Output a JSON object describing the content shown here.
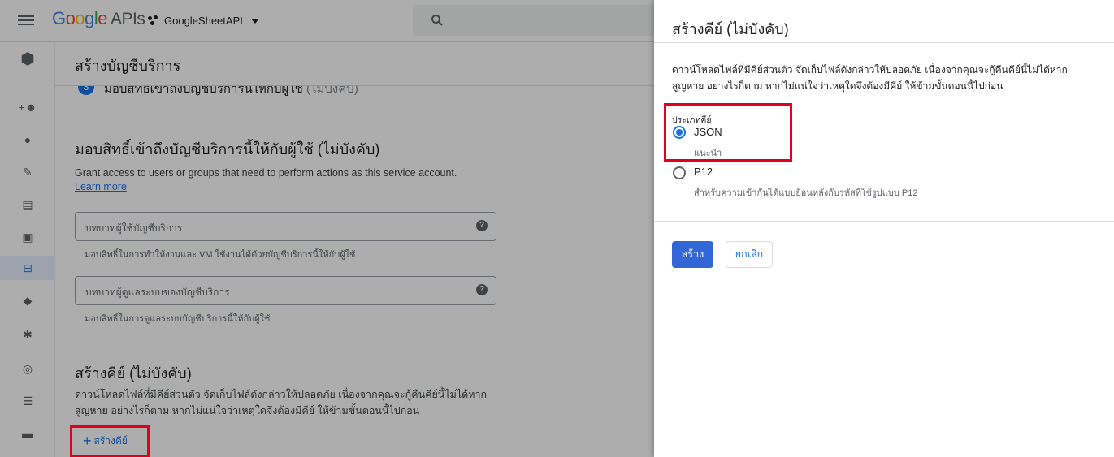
{
  "topbar": {
    "logo_parts": [
      "G",
      "o",
      "o",
      "g",
      "l",
      "e"
    ],
    "logo_suffix": "APIs",
    "project_name": "GoogleSheetAPI"
  },
  "sidebar": {
    "icons": [
      "iam-icon",
      "person-add-icon",
      "account-circle-icon",
      "wrench-icon",
      "article-icon",
      "storage-icon",
      "service-account-icon",
      "label-icon",
      "settings-icon",
      "security-icon",
      "list-icon",
      "folder-icon"
    ]
  },
  "page": {
    "title": "สร้างบัญชีบริการ",
    "step_number": "3",
    "step_text": "มอบสิทธิ์เข้าถึงบัญชีบริการนี้ให้กับผู้ใช้",
    "step_optional": "(ไม่บังคับ)",
    "grant": {
      "heading": "มอบสิทธิ์เข้าถึงบัญชีบริการนี้ให้กับผู้ใช้ (ไม่บังคับ)",
      "description": "Grant access to users or groups that need to perform actions as this service account.",
      "learn_more": "Learn more",
      "user_role_placeholder": "บทบาทผู้ใช้บัญชีบริการ",
      "user_role_hint": "มอบสิทธิ์ในการทำให้งานและ VM ใช้งานได้ด้วยบัญชีบริการนี้ให้กับผู้ใช้",
      "admin_role_placeholder": "บทบาทผู้ดูแลระบบของบัญชีบริการ",
      "admin_role_hint": "มอบสิทธิ์ในการดูแลระบบบัญชีบริการนี้ให้กับผู้ใช้"
    },
    "create_key": {
      "heading": "สร้างคีย์ (ไม่บังคับ)",
      "desc_line1": "ดาวน์โหลดไฟล์ที่มีคีย์ส่วนตัว จัดเก็บไฟล์ดังกล่าวให้ปลอดภัย เนื่องจากคุณจะกู้คืนคีย์นี้ไม่ได้หาก",
      "desc_line2": "สูญหาย อย่างไรก็ตาม หากไม่แน่ใจว่าเหตุใดจึงต้องมีคีย์ ให้ข้ามขั้นตอนนี้ไปก่อน",
      "button_label": "สร้างคีย์"
    }
  },
  "panel": {
    "title": "สร้างคีย์ (ไม่บังคับ)",
    "desc_line1": "ดาวน์โหลดไฟล์ที่มีคีย์ส่วนตัว จัดเก็บไฟล์ดังกล่าวให้ปลอดภัย เนื่องจากคุณจะกู้คืนคีย์นี้ไม่ได้หาก",
    "desc_line2": "สูญหาย อย่างไรก็ตาม หากไม่แน่ใจว่าเหตุใดจึงต้องมีคีย์ ให้ข้ามขั้นตอนนี้ไปก่อน",
    "key_type_label": "ประเภทคีย์",
    "options": [
      {
        "label": "JSON",
        "sub": "แนะนำ",
        "selected": true
      },
      {
        "label": "P12",
        "sub": "สำหรับความเข้ากันได้แบบย้อนหลังกับรหัสที่ใช้รูปแบบ P12",
        "selected": false
      }
    ],
    "create_button": "สร้าง",
    "cancel_button": "ยกเลิก"
  },
  "colors": {
    "accent": "#1a73e8",
    "primary_button": "#3367d6",
    "highlight_box": "#e1001e"
  }
}
